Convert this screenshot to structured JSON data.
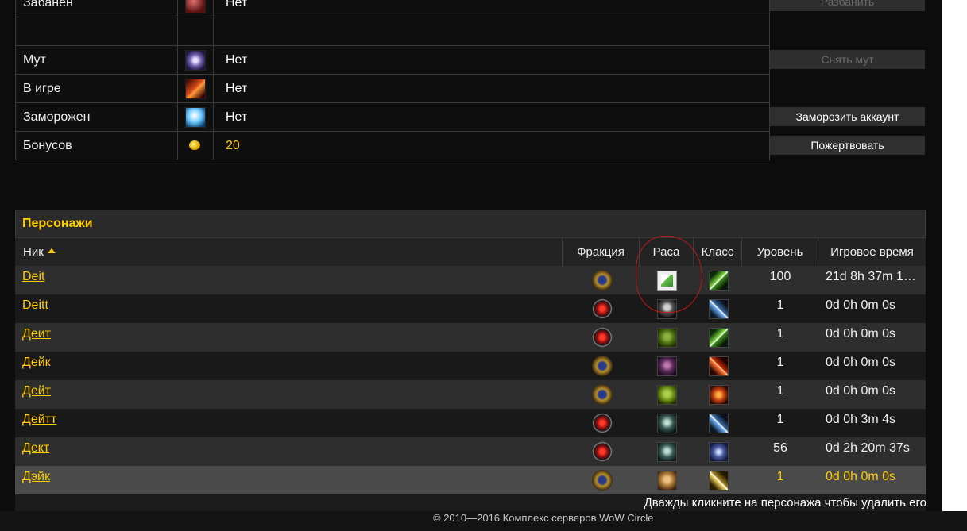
{
  "status_rows": [
    {
      "label": "Забанен",
      "icon": "ban-icon",
      "value": "Нет",
      "button": "Разбанить"
    },
    {
      "label": "",
      "icon": "",
      "value": "",
      "button": ""
    },
    {
      "label": "Мут",
      "icon": "mute-icon",
      "value": "Нет",
      "button": "Снять мут"
    },
    {
      "label": "В игре",
      "icon": "ingame-icon",
      "value": "Нет",
      "button": ""
    },
    {
      "label": "Заморожен",
      "icon": "frozen-icon",
      "value": "Нет",
      "button": "Заморозить аккаунт"
    },
    {
      "label": "Бонусов",
      "icon": "bonus-coin-icon",
      "value": "20",
      "button": "Пожертвовать"
    }
  ],
  "characters": {
    "title": "Персонажи",
    "columns": {
      "nick": "Ник",
      "faction": "Фракция",
      "race": "Раса",
      "class": "Класс",
      "level": "Уровень",
      "playtime": "Игровое время"
    },
    "rows": [
      {
        "nick": "Deit",
        "faction": "alliance",
        "race": "missing-image",
        "class": "hunter",
        "level": "100",
        "playtime": "21d 8h 37m 1…"
      },
      {
        "nick": "Deitt",
        "faction": "horde",
        "race": "undead",
        "class": "warrior",
        "level": "1",
        "playtime": "0d 0h 0m 0s"
      },
      {
        "nick": "Деит",
        "faction": "horde",
        "race": "orc",
        "class": "hunter",
        "level": "1",
        "playtime": "0d 0h 0m 0s"
      },
      {
        "nick": "Дейк",
        "faction": "alliance",
        "race": "blood-elf",
        "class": "mage",
        "level": "1",
        "playtime": "0d 0h 0m 0s"
      },
      {
        "nick": "Дейт",
        "faction": "alliance",
        "race": "goblin",
        "class": "shaman",
        "level": "1",
        "playtime": "0d 0h 0m 0s"
      },
      {
        "nick": "Дейтт",
        "faction": "horde",
        "race": "forsaken",
        "class": "warrior",
        "level": "1",
        "playtime": "0d 0h 3m 4s"
      },
      {
        "nick": "Дект",
        "faction": "horde",
        "race": "forsaken",
        "class": "death-knight",
        "level": "56",
        "playtime": "0d 2h 20m 37s"
      },
      {
        "nick": "Дэйк",
        "faction": "alliance",
        "race": "human",
        "class": "paladin",
        "level": "1",
        "playtime": "0d 0h 0m 0s"
      }
    ],
    "delete_hint": "Дважды кликните на персонажа чтобы удалить его"
  },
  "footer": {
    "copyright": "© 2010—2016 Комплекс серверов WoW Circle"
  },
  "colors": {
    "accent": "#ffcc00",
    "panel_bg": "#0c0c0c",
    "annotation": "#c01818"
  }
}
